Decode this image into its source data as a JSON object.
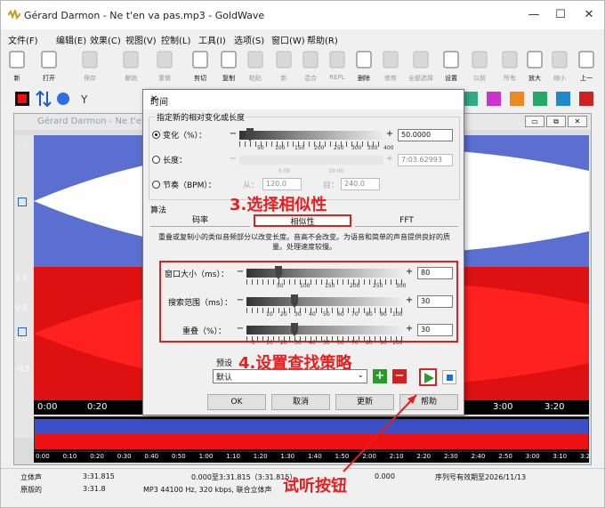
{
  "window": {
    "title": "Gérard Darmon - Ne t'en va pas.mp3 - GoldWave",
    "controls": [
      "—",
      "☐",
      "✕"
    ]
  },
  "menu": [
    "文件(F)",
    "编辑(E)",
    "效果(C)",
    "视图(V)",
    "控制(L)",
    "工具(I)",
    "选项(S)",
    "窗口(W)",
    "帮助(R)"
  ],
  "toolbar": [
    {
      "label": "新",
      "icon": "new-icon"
    },
    {
      "label": "打开",
      "icon": "open-icon"
    },
    {
      "label": "保存",
      "icon": "save-icon",
      "disabled": true
    },
    {
      "label": "撤销",
      "icon": "undo-icon",
      "disabled": true
    },
    {
      "label": "重做",
      "icon": "redo-icon",
      "disabled": true
    },
    {
      "label": "剪切",
      "icon": "cut-icon"
    },
    {
      "label": "复制",
      "icon": "copy-icon"
    },
    {
      "label": "粘贴",
      "icon": "paste-icon",
      "disabled": true
    },
    {
      "label": "新",
      "icon": "paste-new-icon",
      "disabled": true
    },
    {
      "label": "混合",
      "icon": "mix-icon",
      "disabled": true
    },
    {
      "label": "REPL",
      "icon": "replace-icon",
      "disabled": true
    },
    {
      "label": "删除",
      "icon": "delete-icon"
    },
    {
      "label": "修剪",
      "icon": "trim-icon",
      "disabled": true
    },
    {
      "label": "全部选择",
      "icon": "select-all-icon",
      "disabled": true
    },
    {
      "label": "设置",
      "icon": "set-icon"
    },
    {
      "label": "以前",
      "icon": "previous-icon",
      "disabled": true
    },
    {
      "label": "所有",
      "icon": "zoom-all-icon",
      "disabled": true
    },
    {
      "label": "放大",
      "icon": "zoom-in-icon"
    },
    {
      "label": "缩小",
      "icon": "zoom-out-icon",
      "disabled": true
    },
    {
      "label": "上一",
      "icon": "prev-icon"
    }
  ],
  "document": {
    "title": "Gérard Darmon - Ne t'en va pas.mp3",
    "ruler": [
      "0:00",
      "0:20",
      "3:00",
      "3:20"
    ],
    "overview_ruler": [
      "0:00",
      "0:10",
      "0:20",
      "0:30",
      "0:40",
      "0:50",
      "1:00",
      "1:10",
      "1:20",
      "1:30",
      "1:40",
      "1:50",
      "2:00",
      "2:10",
      "2:20",
      "2:30",
      "2:40",
      "2:50",
      "3:00",
      "3:10",
      "3:2"
    ],
    "gutter_top": [
      "1.0",
      "0.5",
      "0.0"
    ],
    "gutter_bottom": [
      "1.0",
      "0.5",
      "0.0",
      "-0.5"
    ]
  },
  "dialog": {
    "title": "时间",
    "group1_label": "指定新的相对变化或长度",
    "change": {
      "label": "变化（%）：",
      "value": "50.0000",
      "ticks": [
        "50",
        "100",
        "150",
        "200",
        "250",
        "300",
        "350",
        "400"
      ]
    },
    "length": {
      "label": "长度：",
      "value": "7:03.62993",
      "ticks": [
        "5:00",
        "10:00"
      ]
    },
    "tempo": {
      "label": "节奏（BPM）：",
      "from_label": "从：",
      "from_value": "120.0",
      "to_label": "目：",
      "to_value": "240.0"
    },
    "algo_label": "算法",
    "tabs": [
      "码率",
      "相似性",
      "FFT"
    ],
    "note": "重叠或复制小的类似音频部分以改变长度。音高不会改变。为语音和简单的声音提供良好的质量。处理速度较慢。",
    "window_size": {
      "label": "窗口大小（ms）：",
      "value": "80",
      "ticks": [
        "50",
        "100",
        "150",
        "200",
        "250",
        "300"
      ]
    },
    "search_range": {
      "label": "搜索范围（ms）：",
      "value": "30",
      "ticks": [
        "10",
        "20",
        "30",
        "40",
        "50",
        "60",
        "70",
        "80",
        "90",
        "100"
      ]
    },
    "overlap": {
      "label": "重叠（%）：",
      "value": "30",
      "ticks": [
        "0",
        "10",
        "20",
        "30",
        "40",
        "50",
        "60",
        "70",
        "80",
        "90",
        "100"
      ]
    },
    "preset_label": "预设",
    "preset_value": "默认",
    "buttons": {
      "ok": "OK",
      "cancel": "取消",
      "update": "更新",
      "help": "帮助"
    }
  },
  "annotations": {
    "step3": "3.选择相似性",
    "step4": "4.设置查找策略",
    "preview": "试听按钮"
  },
  "status": {
    "channel": "立体声",
    "duration": "3:31.815",
    "selection": "0.000至3:31.815（3:31.815）",
    "position": "0.000",
    "registration": "序列号有效期至2026/11/13",
    "original": "原版的",
    "orig_len": "3:31.8",
    "format": "MP3 44100 Hz, 320 kbps, 联合立体声"
  },
  "colors": {
    "wave_left": "#5a6fd0",
    "wave_right": "#dd1111",
    "annotation": "#e81e1e",
    "play": "#2aa02a"
  }
}
